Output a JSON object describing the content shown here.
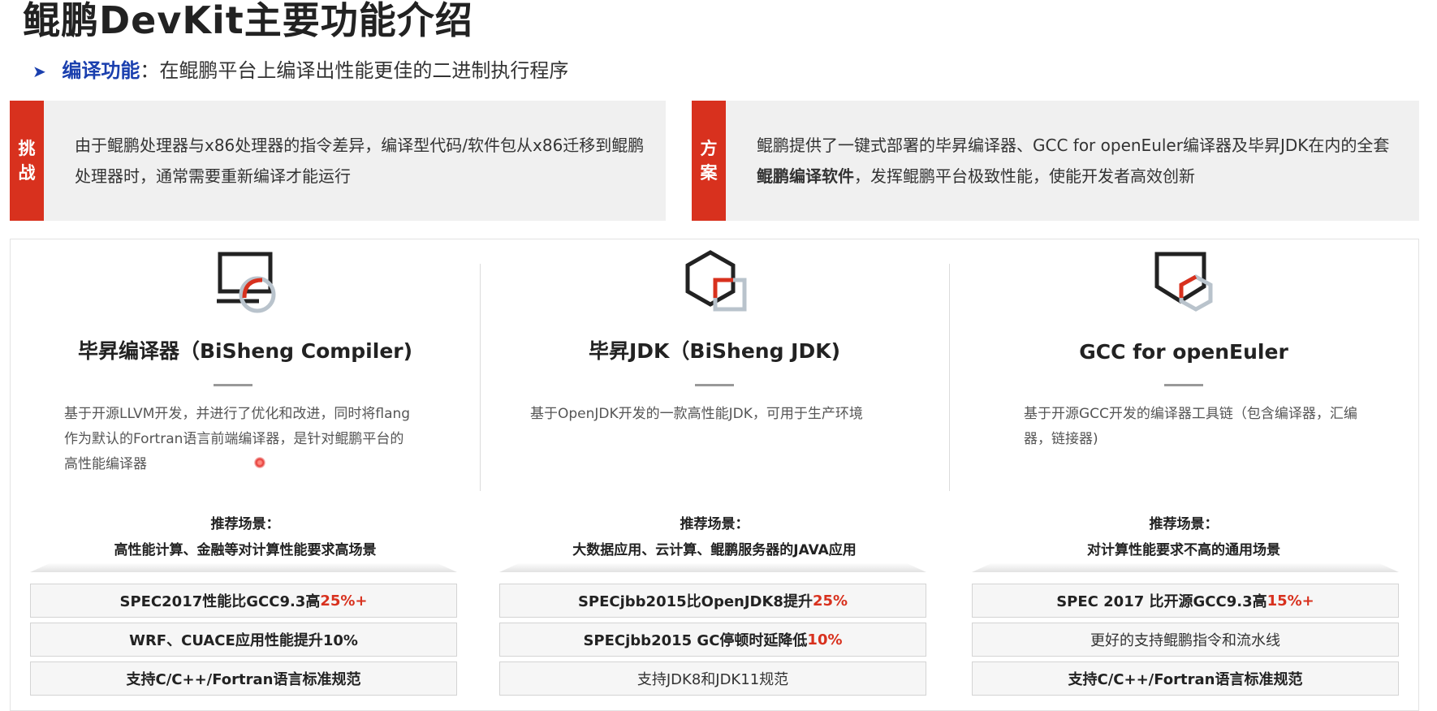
{
  "header": {
    "title": "鲲鹏DevKit主要功能介绍",
    "sub_label": "编译功能",
    "sub_sep": "：",
    "sub_text": "在鲲鹏平台上编译出性能更佳的二进制执行程序"
  },
  "challenge": {
    "tag_1": "挑",
    "tag_2": "战",
    "text": "由于鲲鹏处理器与x86处理器的指令差异，编译型代码/软件包从x86迁移到鲲鹏处理器时，通常需要重新编译才能运行"
  },
  "solution": {
    "tag_1": "方",
    "tag_2": "案",
    "text_a": "鲲鹏提供了一键式部署的毕昇编译器、GCC for openEuler编译器及毕昇JDK在内的全套",
    "text_b": "鲲鹏编译软件",
    "text_c": "，发挥鲲鹏平台极致性能，使能开发者高效创新"
  },
  "colors": {
    "accent": "#d8311e",
    "label_blue": "#1a3fae"
  },
  "columns": [
    {
      "icon": "monitor-icon",
      "title": "毕昇编译器（BiSheng Compiler)",
      "desc": "基于开源LLVM开发，并进行了优化和改进，同时将flang作为默认的Fortran语言前端编译器，是针对鲲鹏平台的高性能编译器",
      "scene_label": "推荐场景：",
      "scene": "高性能计算、金融等对计算性能要求高场景",
      "features": [
        {
          "a": "SPEC2017性能比GCC9.3高",
          "hl": "25%+",
          "b": ""
        },
        {
          "a": "WRF、CUACE应用性能提升10%",
          "hl": "",
          "b": ""
        },
        {
          "a": "支持C/C++/Fortran语言标准规范",
          "hl": "",
          "b": ""
        }
      ]
    },
    {
      "icon": "hexagon-icon",
      "title": "毕昇JDK（BiSheng JDK)",
      "desc": "基于OpenJDK开发的一款高性能JDK，可用于生产环境",
      "scene_label": "推荐场景：",
      "scene": "大数据应用、云计算、鲲鹏服务器的JAVA应用",
      "features": [
        {
          "a": "SPECjbb2015比OpenJDK8提升",
          "hl": "25%",
          "b": ""
        },
        {
          "a": "SPECjbb2015 GC停顿时延降低",
          "hl": "10%",
          "b": ""
        },
        {
          "a": "支持JDK8和JDK11规范",
          "hl": "",
          "b": ""
        }
      ]
    },
    {
      "icon": "shield-icon",
      "title": "GCC for openEuler",
      "desc": "基于开源GCC开发的编译器工具链（包含编译器，汇编器，链接器)",
      "scene_label": "推荐场景：",
      "scene": "对计算性能要求不高的通用场景",
      "features": [
        {
          "a": "SPEC 2017 比开源GCC9.3高",
          "hl": "15%+",
          "b": ""
        },
        {
          "a": "更好的支持鲲鹏指令和流水线",
          "hl": "",
          "b": ""
        },
        {
          "a": "支持C/C++/Fortran语言标准规范",
          "hl": "",
          "b": ""
        }
      ]
    }
  ]
}
